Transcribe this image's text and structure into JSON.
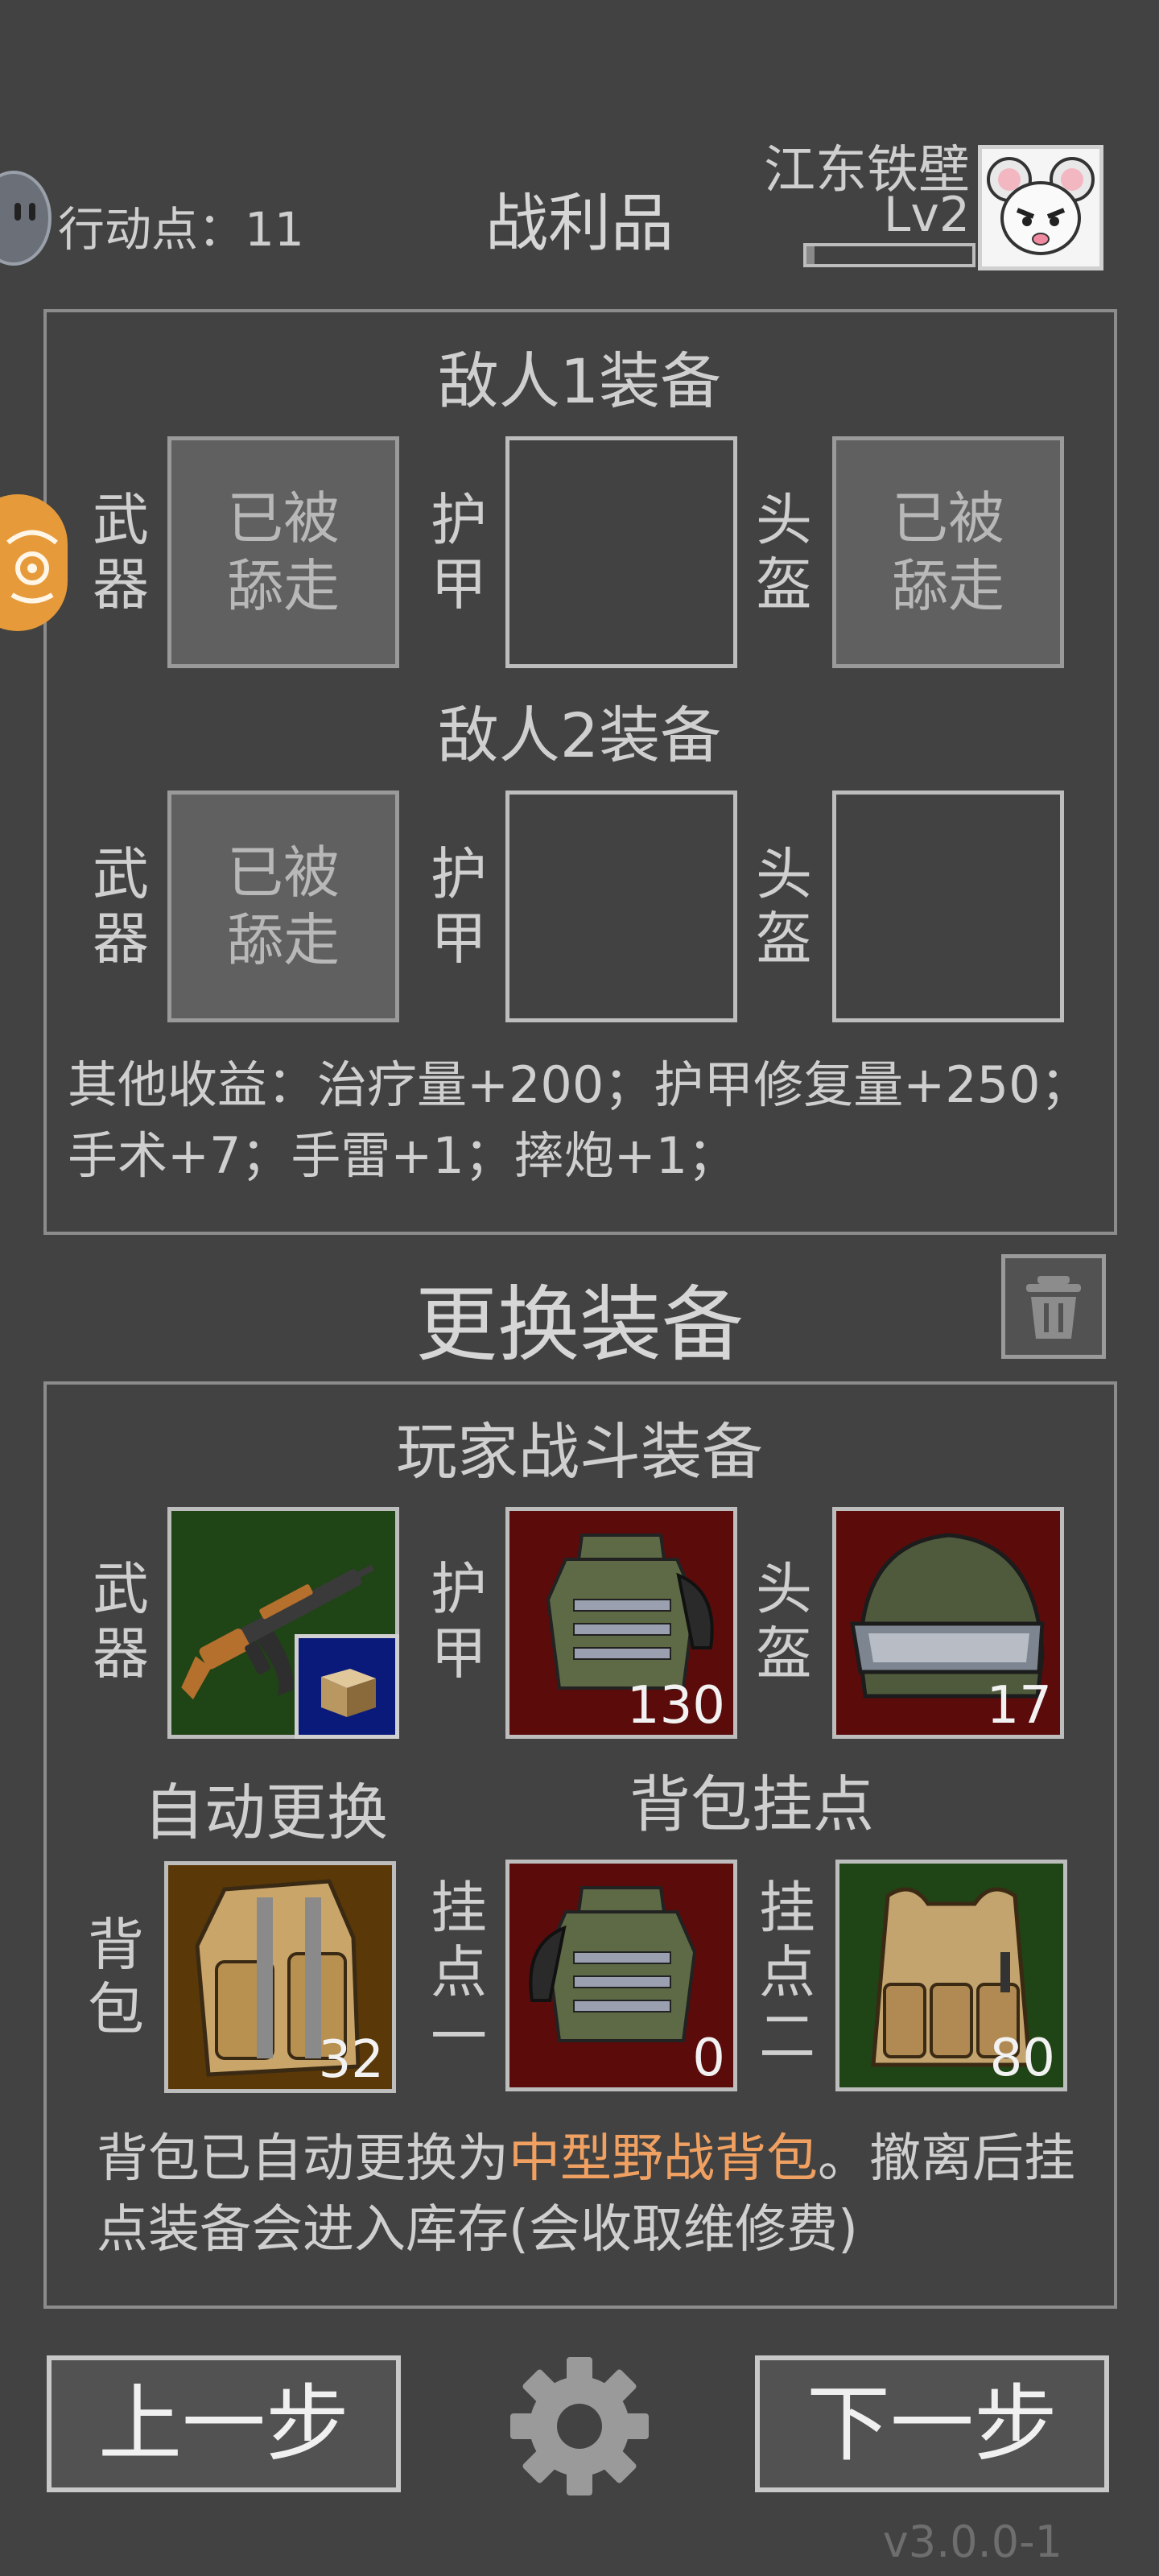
{
  "header": {
    "action_points_label": "行动点：",
    "action_points_value": "11",
    "title": "战利品",
    "player_name": "江东铁壁",
    "player_level": "Lv2",
    "xp_progress": 0.05
  },
  "loot_panel": {
    "enemies": [
      {
        "title": "敌人1装备",
        "slots": [
          {
            "label": "武\n器",
            "state": "taken",
            "text": "已被\n舔走"
          },
          {
            "label": "护\n甲",
            "state": "empty",
            "text": ""
          },
          {
            "label": "头\n盔",
            "state": "taken",
            "text": "已被\n舔走"
          }
        ]
      },
      {
        "title": "敌人2装备",
        "slots": [
          {
            "label": "武\n器",
            "state": "taken",
            "text": "已被\n舔走"
          },
          {
            "label": "护\n甲",
            "state": "empty",
            "text": ""
          },
          {
            "label": "头\n盔",
            "state": "empty",
            "text": ""
          }
        ]
      }
    ],
    "other_gains": "其他收益：治疗量+200；护甲修复量+250；手术+7；手雷+1；摔炮+1；"
  },
  "change_section": {
    "title": "更换装备",
    "trash_icon": "trash-icon"
  },
  "player_panel": {
    "title": "玩家战斗装备",
    "weapon_label": "武\n器",
    "armor_label": "护\n甲",
    "armor_value": "130",
    "helmet_label": "头\n盔",
    "helmet_value": "17",
    "auto_replace_label": "自动更换",
    "backpack_mounts_label": "背包挂点",
    "backpack_label": "背\n包",
    "backpack_value": "32",
    "mount1_label": "挂\n点\n一",
    "mount1_value": "0",
    "mount2_label": "挂\n点\n二",
    "mount2_value": "80",
    "note_prefix": "背包已自动更换为",
    "note_highlight": "中型野战背包",
    "note_suffix": "。撤离后挂点装备会进入库存(会收取维修费)",
    "colors": {
      "highlight": "#f0a060",
      "green_slot": "#1f4415",
      "red_slot": "#5c0b0b",
      "brown_slot": "#5a3808",
      "blue_badge": "#0a1a7a"
    }
  },
  "footer": {
    "prev_label": "上一步",
    "next_label": "下一步",
    "settings_icon": "gear-icon",
    "version": "v3.0.0-1"
  }
}
